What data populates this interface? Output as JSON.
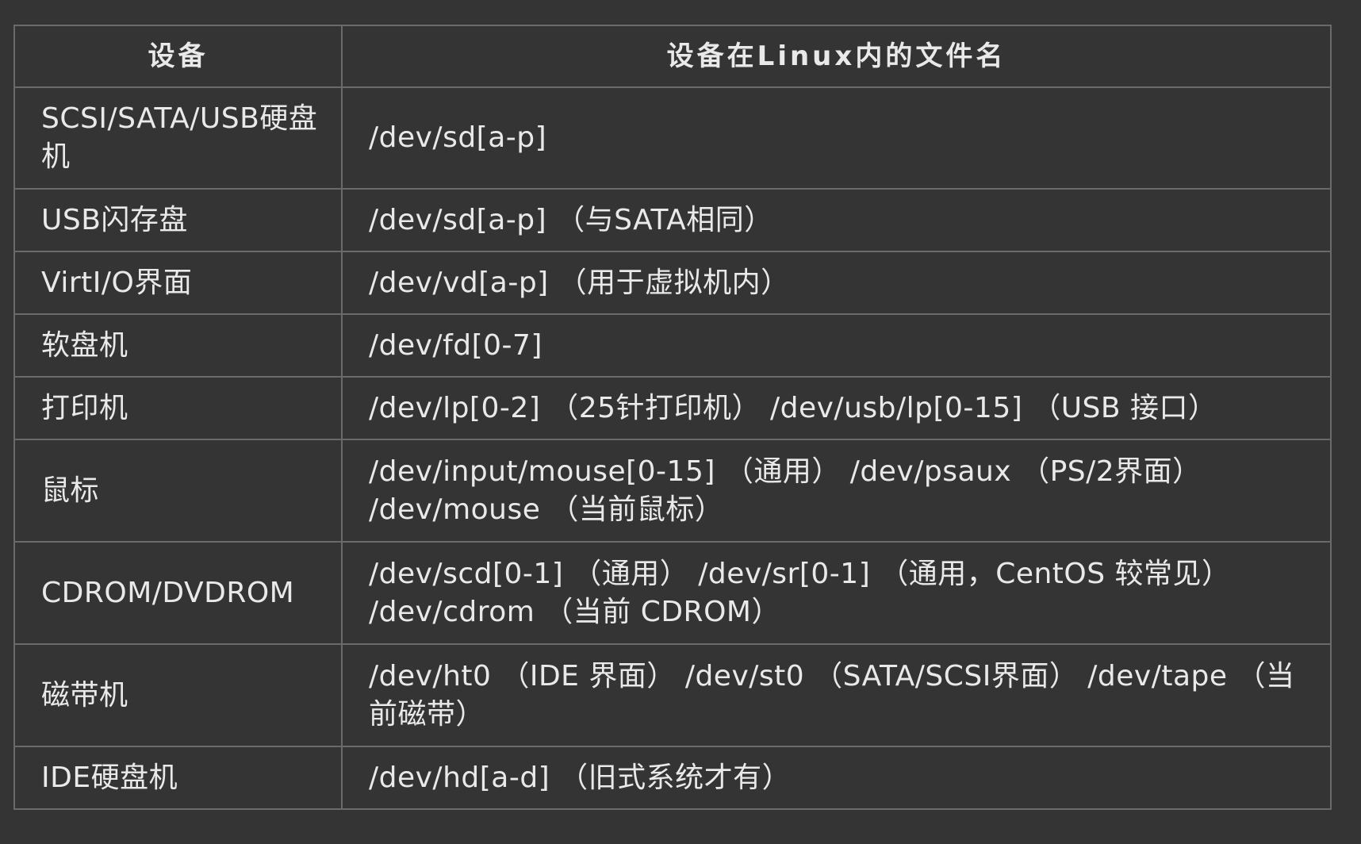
{
  "table": {
    "headers": {
      "device": "设备",
      "filename": "设备在Linux内的文件名"
    },
    "rows": [
      {
        "device": "SCSI/SATA/USB硬盘机",
        "filename": "/dev/sd[a-p]"
      },
      {
        "device": "USB闪存盘",
        "filename": "/dev/sd[a-p] （与SATA相同）"
      },
      {
        "device": "VirtI/O界面",
        "filename": "/dev/vd[a-p] （用于虚拟机内）"
      },
      {
        "device": "软盘机",
        "filename": "/dev/fd[0-7]"
      },
      {
        "device": "打印机",
        "filename": "/dev/lp[0-2] （25针打印机） /dev/usb/lp[0-15] （USB 接口）"
      },
      {
        "device": "鼠标",
        "filename": "/dev/input/mouse[0-15] （通用） /dev/psaux （PS/2界面） /dev/mouse （当前鼠标）"
      },
      {
        "device": "CDROM/DVDROM",
        "filename": "/dev/scd[0-1] （通用） /dev/sr[0-1] （通用，CentOS 较常见） /dev/cdrom （当前 CDROM）"
      },
      {
        "device": "磁带机",
        "filename": "/dev/ht0 （IDE 界面） /dev/st0 （SATA/SCSI界面） /dev/tape （当前磁带）"
      },
      {
        "device": "IDE硬盘机",
        "filename": "/dev/hd[a-d] （旧式系统才有）"
      }
    ]
  }
}
